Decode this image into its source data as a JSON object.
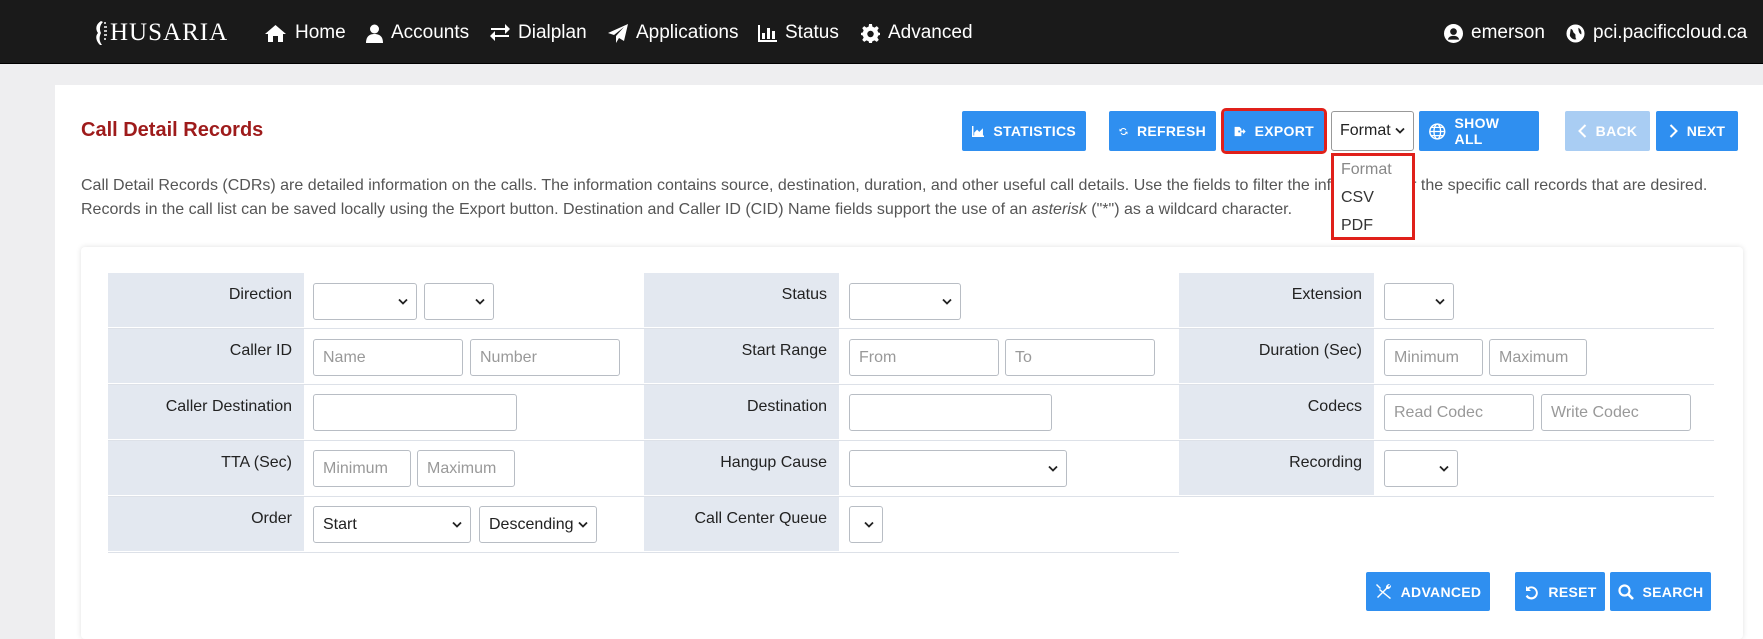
{
  "brand": "HUSARIA",
  "nav": {
    "home": "Home",
    "accounts": "Accounts",
    "dialplan": "Dialplan",
    "applications": "Applications",
    "status": "Status",
    "advanced": "Advanced",
    "user": "emerson",
    "domain": "pci.pacificcloud.ca"
  },
  "page": {
    "title": "Call Detail Records",
    "desc_1": "Call Detail Records (CDRs) are detailed information on the calls. The information contains source, destination, duration, and other useful call details. Use the fields to filter the information for the specific call records that are desired. Records in the call list can be saved locally using the Export button.   Destination and Caller ID (CID) Name fields support the use of an ",
    "desc_em": "asterisk",
    "desc_2": " (\"*\") as a wildcard character."
  },
  "toolbar": {
    "statistics": "STATISTICS",
    "refresh": "REFRESH",
    "export": "EXPORT",
    "format_selected": "Format",
    "format_options": [
      "Format",
      "CSV",
      "PDF"
    ],
    "show_all": "SHOW ALL",
    "back": "BACK",
    "next": "NEXT"
  },
  "filters": {
    "direction": "Direction",
    "caller_id": "Caller ID",
    "caller_destination": "Caller Destination",
    "tta": "TTA (Sec)",
    "order": "Order",
    "status": "Status",
    "start_range": "Start Range",
    "destination": "Destination",
    "hangup_cause": "Hangup Cause",
    "call_center_queue": "Call Center Queue",
    "extension": "Extension",
    "duration": "Duration (Sec)",
    "codecs": "Codecs",
    "recording": "Recording",
    "ph_name": "Name",
    "ph_number": "Number",
    "ph_from": "From",
    "ph_to": "To",
    "ph_minimum": "Minimum",
    "ph_maximum": "Maximum",
    "ph_read_codec": "Read Codec",
    "ph_write_codec": "Write Codec",
    "order_field": "Start",
    "order_dir": "Descending"
  },
  "actions": {
    "advanced": "ADVANCED",
    "reset": "RESET",
    "search": "SEARCH"
  },
  "colors": {
    "accent": "#2f8ff0",
    "title": "#9e1b1b",
    "highlight": "#e0201a",
    "label_bg": "#e3e8f0"
  }
}
